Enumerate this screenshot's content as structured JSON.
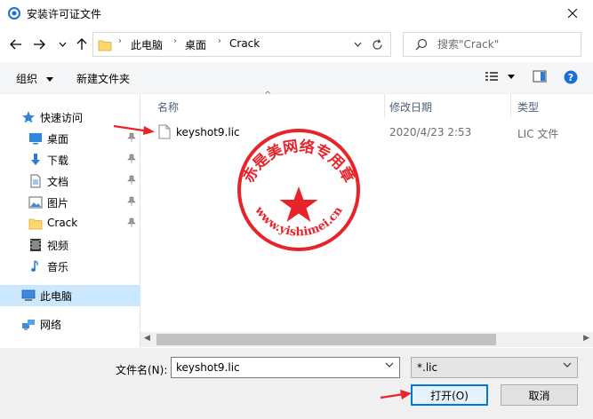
{
  "window": {
    "title": "安装许可证文件",
    "icon": "dialog-app-icon",
    "close": "close-icon"
  },
  "address": {
    "crumbs": [
      "此电脑",
      "桌面",
      "Crack"
    ],
    "search_placeholder": "搜索\"Crack\""
  },
  "toolbar": {
    "organize": "组织",
    "new_folder": "新建文件夹"
  },
  "sidebar": {
    "quick_access": "快速访问",
    "items": [
      {
        "label": "桌面",
        "icon": "desktop-icon"
      },
      {
        "label": "下载",
        "icon": "download-icon"
      },
      {
        "label": "文档",
        "icon": "document-icon"
      },
      {
        "label": "图片",
        "icon": "pictures-icon"
      },
      {
        "label": "Crack",
        "icon": "folder-icon"
      },
      {
        "label": "视频",
        "icon": "video-icon"
      },
      {
        "label": "音乐",
        "icon": "music-icon"
      }
    ],
    "this_pc": "此电脑",
    "network": "网络"
  },
  "columns": {
    "name": "名称",
    "date": "修改日期",
    "type": "类型"
  },
  "files": [
    {
      "name": "keyshot9.lic",
      "date": "2020/4/23 2:53",
      "type": "LIC 文件"
    }
  ],
  "bottom": {
    "filename_label": "文件名(N):",
    "filename_value": "keyshot9.lic",
    "filter_value": "*.lic",
    "open_button": "打开(O)",
    "cancel_button": "取消"
  },
  "stamp": {
    "text_top": "赤是美网络专用章",
    "text_bottom": "www.yishimei.cn"
  },
  "colors": {
    "accent": "#0078d7",
    "selection": "#cce8ff",
    "annotation_red": "#e8232a",
    "header_text": "#4c607a"
  }
}
